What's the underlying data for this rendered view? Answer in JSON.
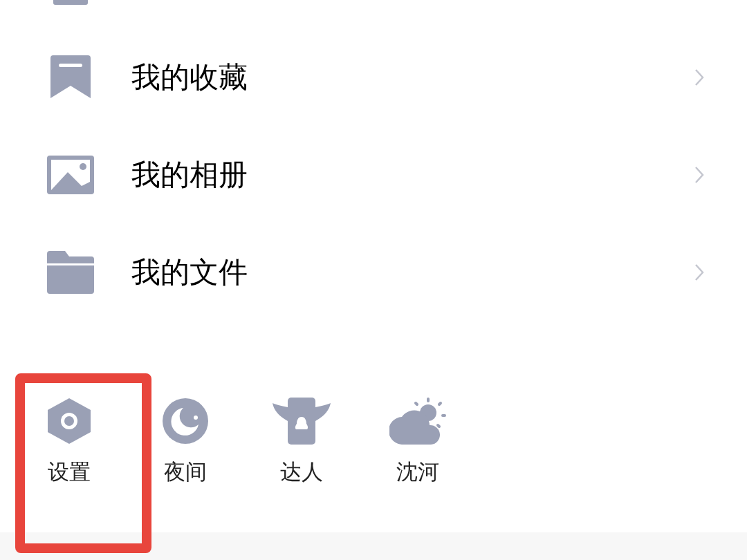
{
  "menu": [
    {
      "kind": "bookmark",
      "label": "我的收藏"
    },
    {
      "kind": "photo",
      "label": "我的相册"
    },
    {
      "kind": "folder",
      "label": "我的文件"
    }
  ],
  "shortcuts": [
    {
      "kind": "settings",
      "label": "设置",
      "highlighted": true
    },
    {
      "kind": "night",
      "label": "夜间",
      "highlighted": false
    },
    {
      "kind": "vip",
      "label": "达人",
      "highlighted": false
    },
    {
      "kind": "weather",
      "label": "沈河",
      "highlighted": false
    }
  ]
}
